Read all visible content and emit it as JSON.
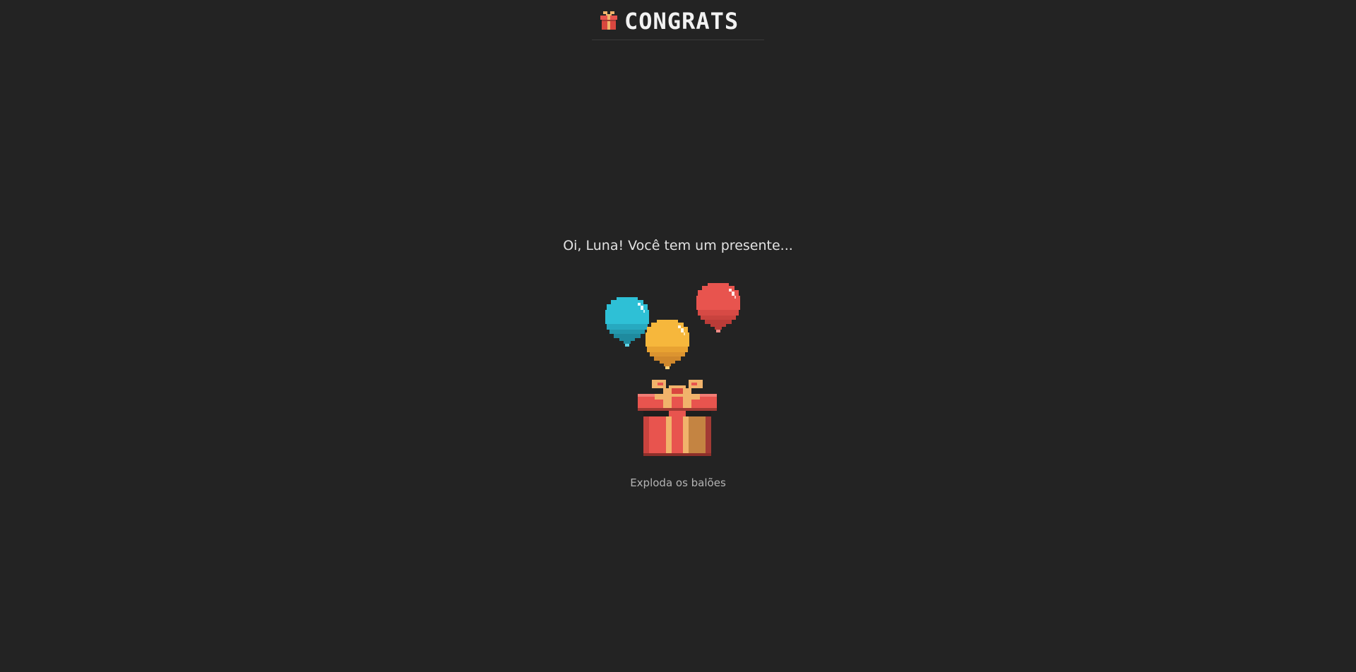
{
  "header": {
    "title": "CONGRATS",
    "icon": "gift-icon"
  },
  "main": {
    "greeting": "Oi, Luna! Você tem um presente...",
    "hint": "Exploda os balões"
  },
  "balloons": [
    {
      "name": "balloon-blue",
      "color": "#2ec0d6"
    },
    {
      "name": "balloon-yellow",
      "color": "#f6b73c"
    },
    {
      "name": "balloon-red",
      "color": "#e8544e"
    }
  ],
  "colors": {
    "background": "#232323",
    "title": "#f2f2f2",
    "gift_box": "#e8544e",
    "gift_ribbon": "#f1b36b"
  }
}
